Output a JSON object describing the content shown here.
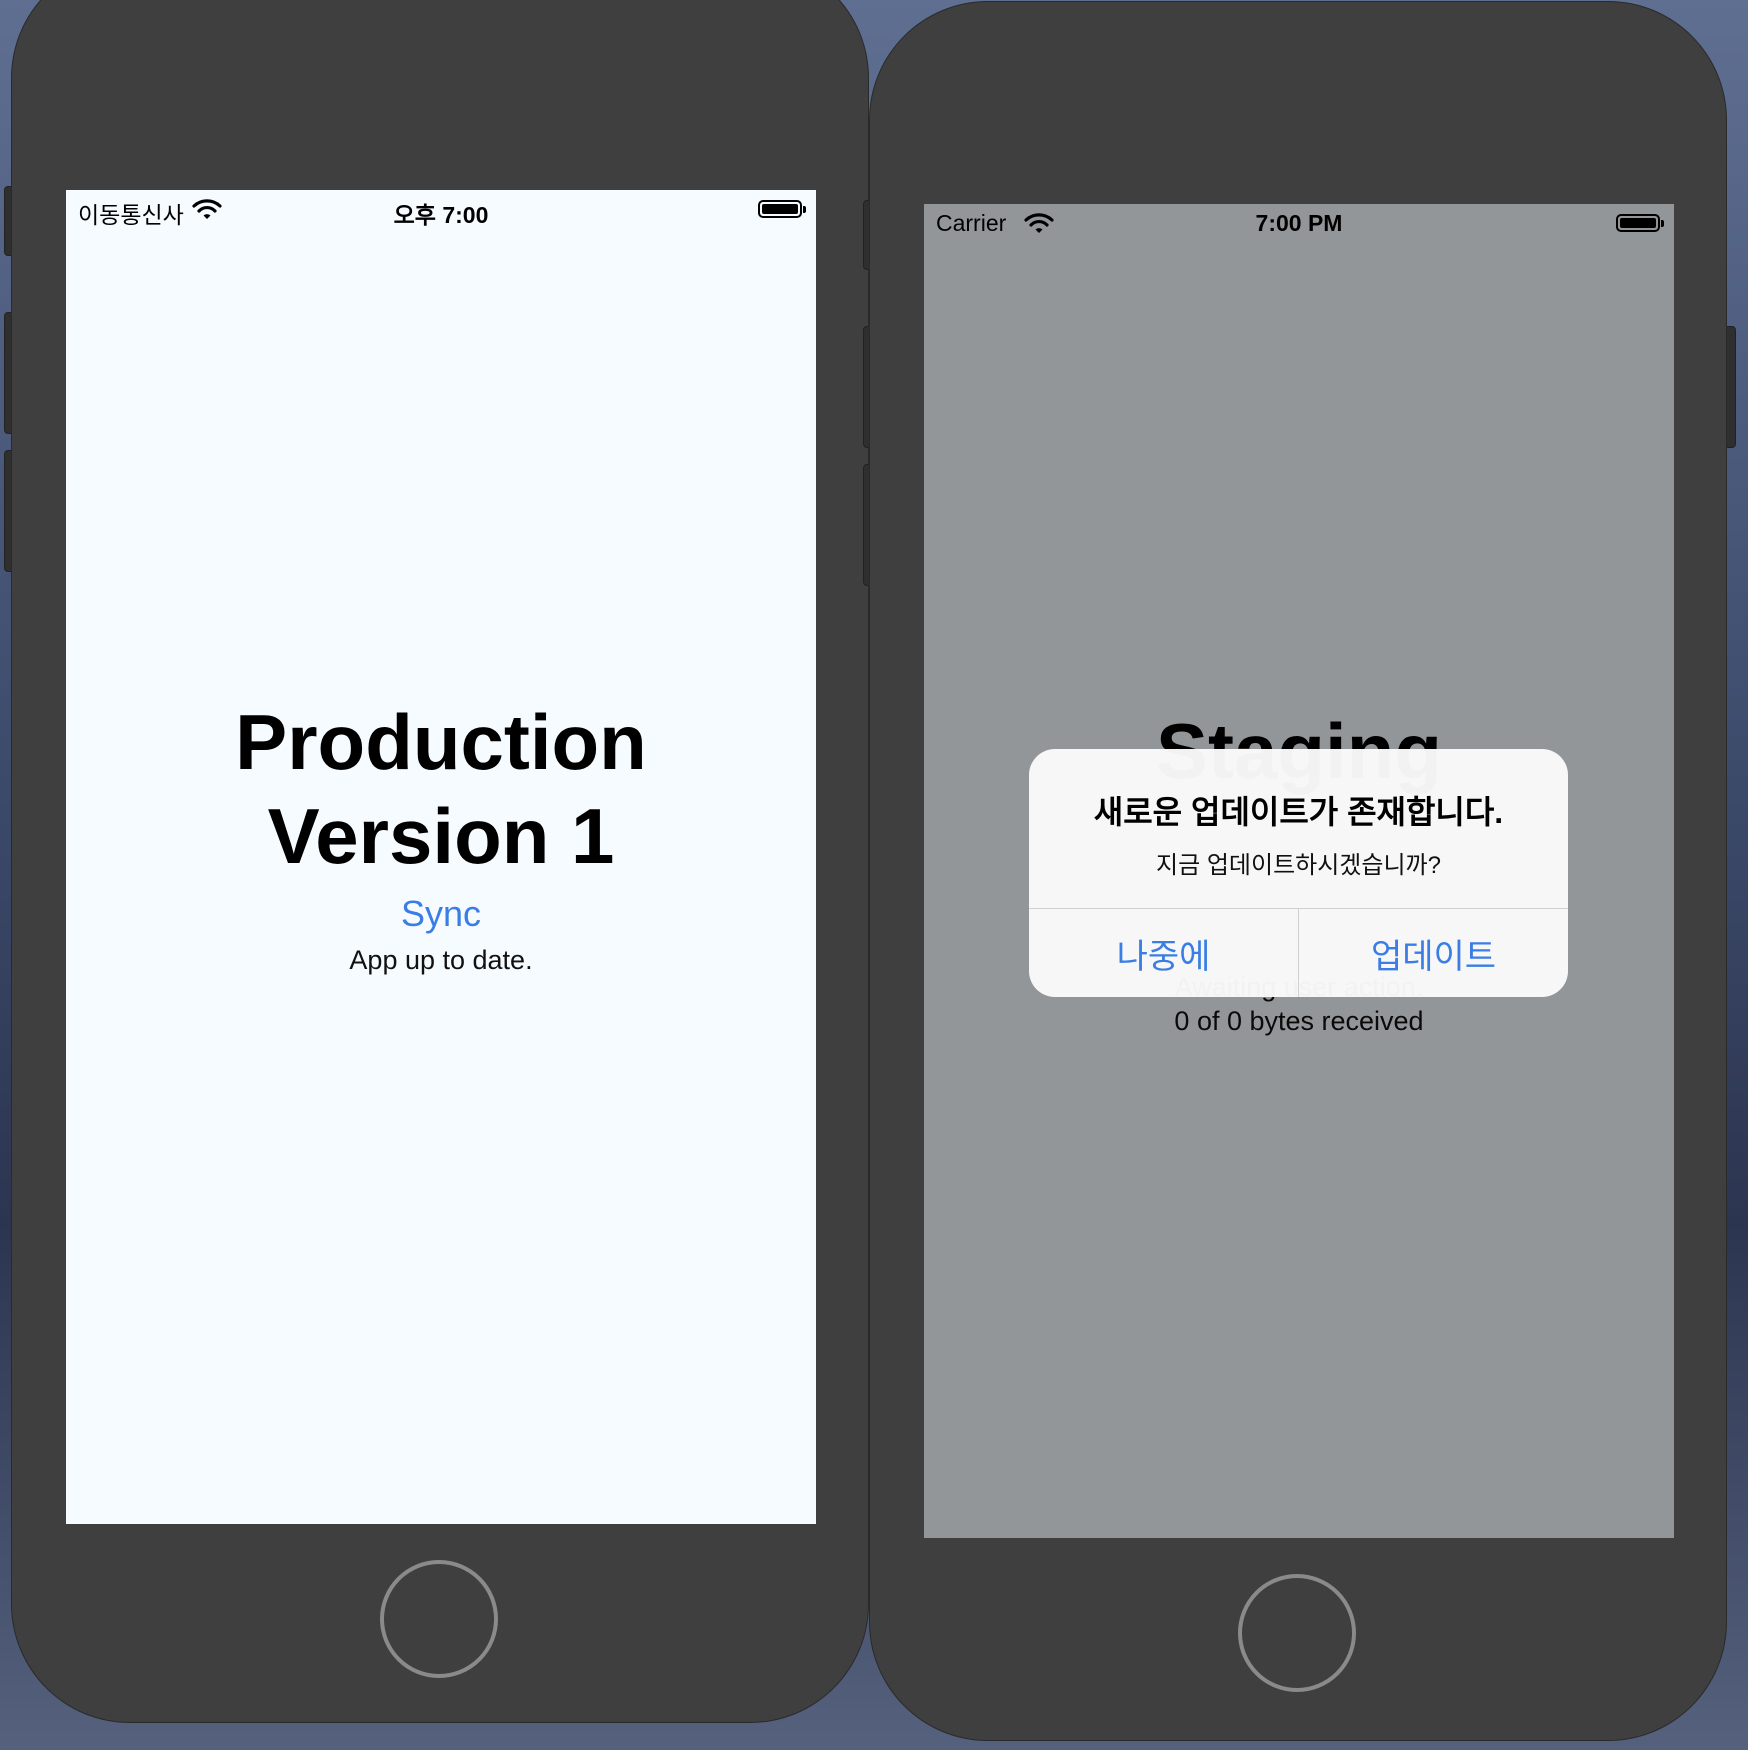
{
  "left_phone": {
    "status": {
      "carrier": "이동통신사",
      "time": "오후 7:00"
    },
    "title_line1": "Production",
    "title_line2": "Version 1",
    "sync_label": "Sync",
    "status_message": "App up to date."
  },
  "right_phone": {
    "status": {
      "carrier": "Carrier",
      "time": "7:00 PM"
    },
    "title_partial": "Staging",
    "status_partial": "Awaiting user action.",
    "bytes_message": "0 of 0 bytes received",
    "alert": {
      "title": "새로운 업데이트가 존재합니다.",
      "message": "지금 업데이트하시겠습니까?",
      "later_label": "나중에",
      "update_label": "업데이트"
    }
  },
  "colors": {
    "accent": "#3a7de4",
    "left_screen_bg": "#f6fbff",
    "right_screen_bg": "#94989a",
    "device_body": "#3f3f3f"
  }
}
